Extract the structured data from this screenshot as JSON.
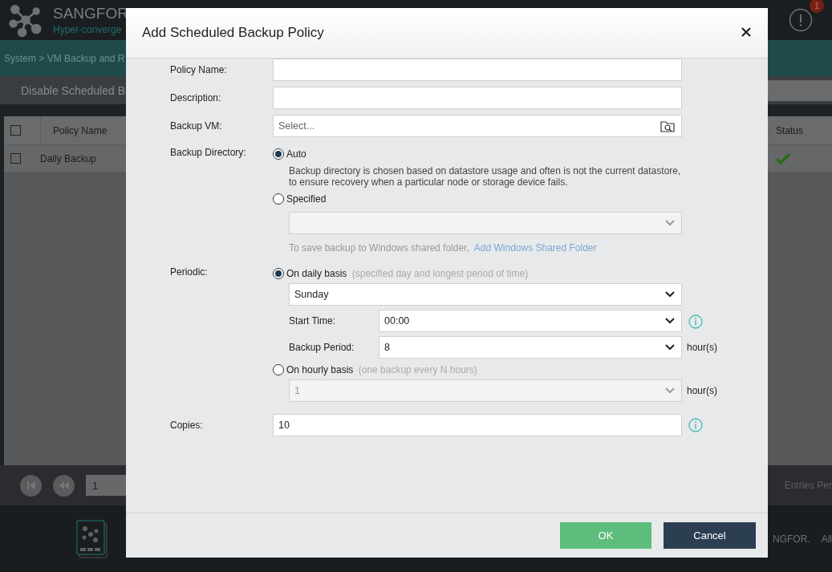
{
  "app": {
    "brand": "SANGFOR",
    "subtitle": "Hyper-converge",
    "alerts": "1",
    "breadcrumb": "System > VM Backup and R",
    "toolbar_button": "Disable Scheduled B",
    "table": {
      "all_selected": false,
      "columns": [
        "Policy Name",
        "Status"
      ],
      "rows": [
        {
          "selected": false,
          "name": "Daily Backup",
          "enabled": true
        }
      ]
    },
    "pager": {
      "page": "1",
      "entries": "Entries Per"
    },
    "footer": [
      "NGFOR.",
      "All"
    ]
  },
  "dialog": {
    "title": "Add Scheduled Backup Policy",
    "policy_name": {
      "label": "Policy Name:"
    },
    "description": {
      "label": "Description:"
    },
    "backup_vm": {
      "label": "Backup VM:",
      "placeholder": "Select..."
    },
    "backup_directory": {
      "label": "Backup Directory:",
      "options": [
        {
          "label": "Auto",
          "selected": true,
          "note": "Backup directory is chosen based on datastore usage and often is not the current datastore, to ensure recovery when a particular node or storage device fails."
        },
        {
          "label": "Specified",
          "selected": false
        }
      ],
      "share_note": "To save backup to Windows shared folder,",
      "share_link": "Add Windows Shared Folder"
    },
    "periodic": {
      "label": "Periodic:",
      "options": [
        {
          "kind": "daily",
          "label": "On daily basis",
          "hint": "(specified day and longest period of time)",
          "selected": true,
          "day": "Sunday",
          "start_time_label": "Start Time:",
          "start_time": "00:00",
          "period_label": "Backup Period:",
          "period": "8",
          "unit": "hour(s)"
        },
        {
          "kind": "hourly",
          "label": "On hourly basis",
          "hint": "(one backup every N hours)",
          "selected": false,
          "value": "1",
          "unit": "hour(s)"
        }
      ]
    },
    "copies": {
      "label": "Copies:",
      "value": "10"
    },
    "buttons": [
      {
        "label": "OK",
        "kind": "primary"
      },
      {
        "label": "Cancel",
        "kind": "secondary"
      }
    ]
  }
}
